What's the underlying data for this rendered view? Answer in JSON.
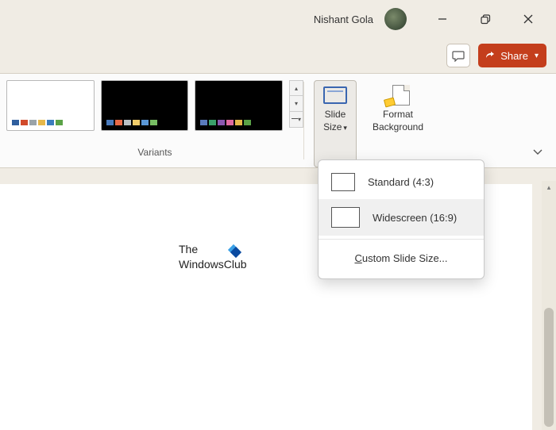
{
  "titlebar": {
    "user_name": "Nishant Gola"
  },
  "subbar": {
    "share_label": "Share"
  },
  "ribbon": {
    "variants_label": "Variants",
    "slide_size": {
      "line1": "Slide",
      "line2": "Size"
    },
    "format_bg": {
      "line1": "Format",
      "line2": "Background"
    },
    "variant_swatches": {
      "light": [
        "#2f5f9e",
        "#d14a2b",
        "#9aa3a8",
        "#e6b84a",
        "#3b7dbd",
        "#5aa246"
      ],
      "dark1": [
        "#4a7bbd",
        "#e86a47",
        "#b9c0c4",
        "#f0cc6a",
        "#5a97d6",
        "#77bd63"
      ],
      "dark2": [
        "#5a7bbd",
        "#3aa06a",
        "#8a57b0",
        "#e06aa0",
        "#e6b84a",
        "#5aa246"
      ]
    }
  },
  "dropdown": {
    "standard_label": "Standard (4:3)",
    "widescreen_label": "Widescreen (16:9)",
    "custom_prefix": "C",
    "custom_rest": "ustom Slide Size..."
  },
  "slide": {
    "line1": "The",
    "line2": "WindowsClub"
  }
}
